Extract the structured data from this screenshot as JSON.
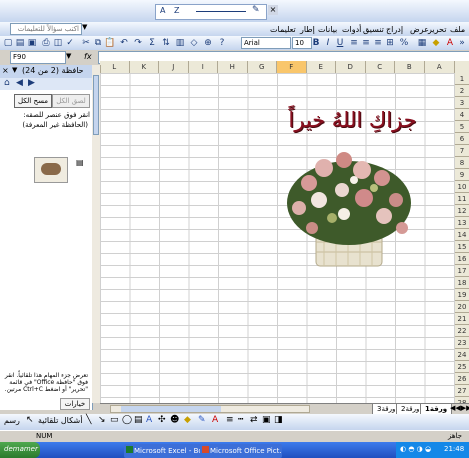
{
  "format_toolbar": {
    "style_chips": [
      "A",
      "Z"
    ]
  },
  "menu": {
    "ask_placeholder": "اكتب سؤالاً للتعليمات",
    "items": [
      "ملف",
      "تحرير",
      "عرض",
      "إدراج",
      "تنسيق",
      "أدوات",
      "بيانات",
      "إطار",
      "تعليمات"
    ]
  },
  "standard_toolbar": {
    "font": "Arial",
    "size": "10",
    "bold": "B",
    "italic": "I",
    "underline": "U",
    "percent": "%",
    "sigma": "Σ"
  },
  "formula_bar": {
    "name_box": "F90",
    "fx": "fx"
  },
  "task_pane": {
    "title": "حافظة (2 من 24)",
    "paste_all": "لصق الكل",
    "clear_all": "مسح الكل",
    "instruction": "انقر فوق عنصر للصقه:",
    "item1": "(الحافظة غير المعرفة)",
    "footer_text": "تعرض جزء المهام هذا تلقائياً. انقر فوق \"حافظة Office\" في قائمة \"تحرير\" أو اضغط Ctrl+C مرتين.",
    "options": "خيارات"
  },
  "sheet": {
    "columns": [
      "L",
      "K",
      "J",
      "I",
      "H",
      "G",
      "F",
      "E",
      "D",
      "C",
      "B",
      "A"
    ],
    "active_column": "F",
    "rows": [
      "1",
      "2",
      "3",
      "4",
      "5",
      "6",
      "7",
      "8",
      "9",
      "10",
      "11",
      "12",
      "13",
      "14",
      "15",
      "16",
      "17",
      "18",
      "19",
      "20",
      "21",
      "22",
      "23",
      "24",
      "25",
      "26",
      "27",
      "28",
      "29",
      "30",
      "31",
      "32",
      "33"
    ],
    "active_row": "",
    "calligraphy": "جزاكِ اللهُ خيراً"
  },
  "sheet_tabs": [
    "ورقة1",
    "ورقة2",
    "ورقة3"
  ],
  "drawing_toolbar": {
    "draw": "رسم",
    "autoshapes": "أشكال تلقائية"
  },
  "status_bar": {
    "num": "NUM",
    "ready": "جاهز"
  },
  "taskbar": {
    "start": "demamer",
    "tasks": [
      "Microsoft Excel - Book1",
      "Microsoft Office Pict..."
    ],
    "clock": "21:48"
  }
}
